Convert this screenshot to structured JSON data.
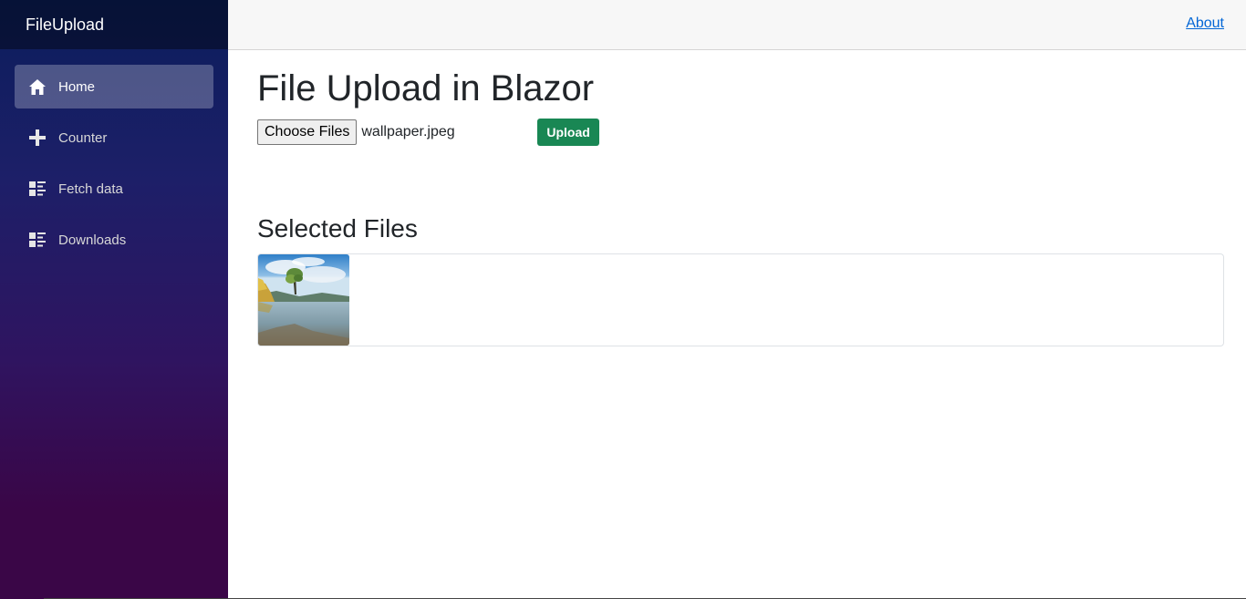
{
  "app": {
    "brand": "FileUpload"
  },
  "sidebar": {
    "items": [
      {
        "label": "Home",
        "icon": "home-icon",
        "active": true
      },
      {
        "label": "Counter",
        "icon": "plus-icon",
        "active": false
      },
      {
        "label": "Fetch data",
        "icon": "list-rich-icon",
        "active": false
      },
      {
        "label": "Downloads",
        "icon": "list-rich-icon",
        "active": false
      }
    ]
  },
  "header": {
    "about_label": "About"
  },
  "main": {
    "title": "File Upload in Blazor",
    "file_input": {
      "button_label": "Choose Files",
      "selected_file": "wallpaper.jpeg"
    },
    "upload_label": "Upload",
    "selected_title": "Selected Files",
    "selected_files": [
      {
        "thumbnail": "landscape-lake-tree-image"
      }
    ]
  },
  "colors": {
    "accent": "#198754",
    "link": "#0366d6",
    "sidebar_top": "#0b1e5c",
    "sidebar_bottom": "#3a0647"
  }
}
